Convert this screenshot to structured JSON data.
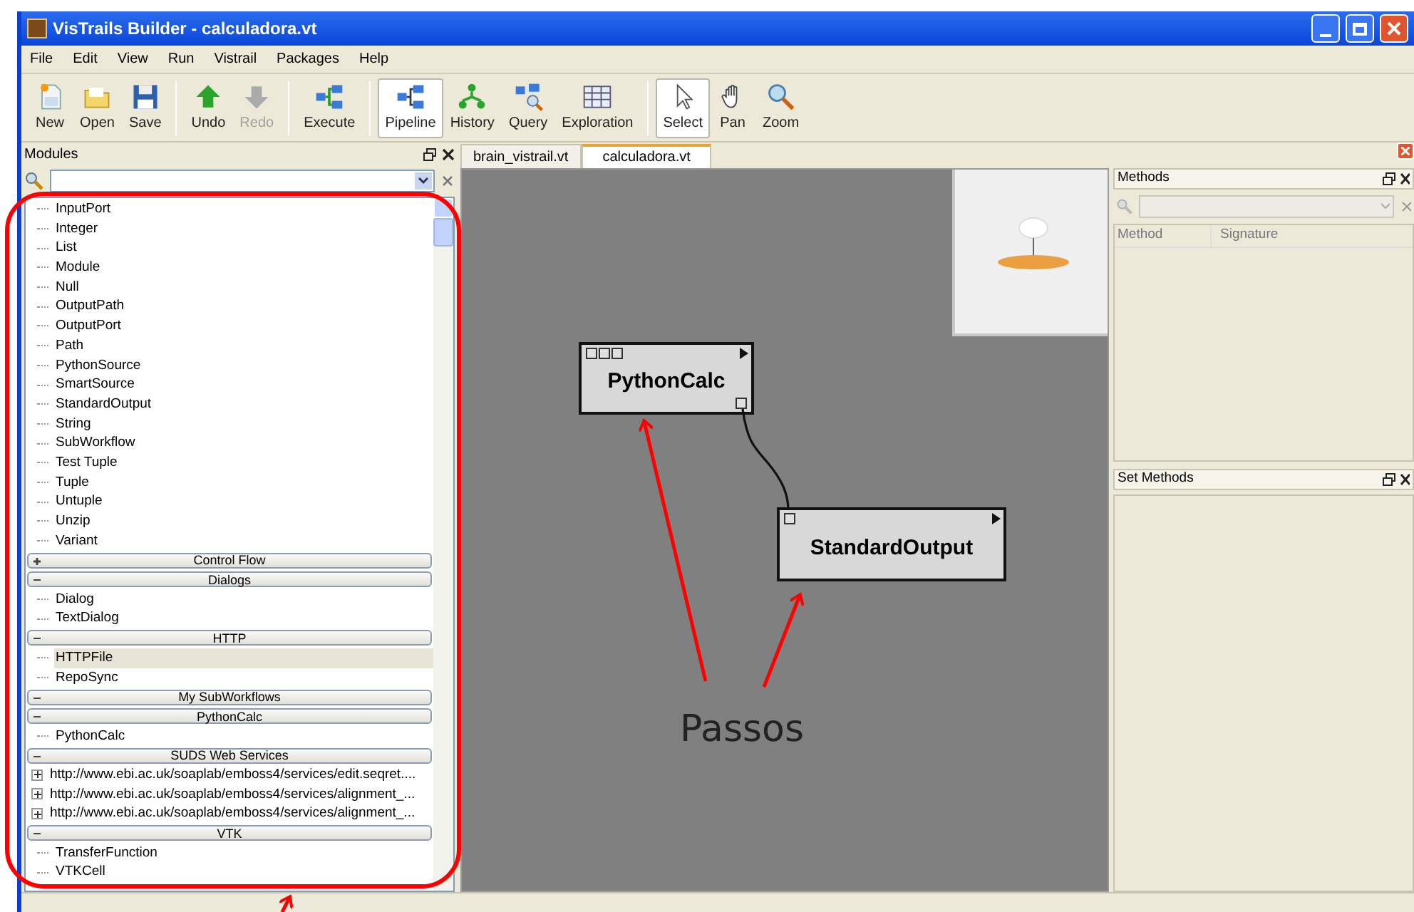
{
  "window": {
    "title": "VisTrails Builder - calculadora.vt"
  },
  "menu": [
    "File",
    "Edit",
    "View",
    "Run",
    "Vistrail",
    "Packages",
    "Help"
  ],
  "toolbar": [
    [
      {
        "label": "New",
        "kind": "new",
        "selected": false,
        "disabled": false
      },
      {
        "label": "Open",
        "kind": "open",
        "selected": false,
        "disabled": false
      },
      {
        "label": "Save",
        "kind": "save",
        "selected": false,
        "disabled": false
      }
    ],
    [
      {
        "label": "Undo",
        "kind": "undo",
        "selected": false,
        "disabled": false
      },
      {
        "label": "Redo",
        "kind": "redo",
        "selected": false,
        "disabled": true
      }
    ],
    [
      {
        "label": "Execute",
        "kind": "execute",
        "selected": false,
        "disabled": false
      }
    ],
    [
      {
        "label": "Pipeline",
        "kind": "pipeline",
        "selected": true,
        "disabled": false
      },
      {
        "label": "History",
        "kind": "history",
        "selected": false,
        "disabled": false
      },
      {
        "label": "Query",
        "kind": "query",
        "selected": false,
        "disabled": false
      },
      {
        "label": "Exploration",
        "kind": "exploration",
        "selected": false,
        "disabled": false
      }
    ],
    [
      {
        "label": "Select",
        "kind": "select",
        "selected": true,
        "disabled": false
      },
      {
        "label": "Pan",
        "kind": "pan",
        "selected": false,
        "disabled": false
      },
      {
        "label": "Zoom",
        "kind": "zoom",
        "selected": false,
        "disabled": false
      }
    ]
  ],
  "modules": {
    "title": "Modules",
    "tree": [
      {
        "kind": "item",
        "label": "InputPort",
        "selected": false
      },
      {
        "kind": "item",
        "label": "Integer",
        "selected": false
      },
      {
        "kind": "item",
        "label": "List",
        "selected": false
      },
      {
        "kind": "item",
        "label": "Module",
        "selected": false
      },
      {
        "kind": "item",
        "label": "Null",
        "selected": false
      },
      {
        "kind": "item",
        "label": "OutputPath",
        "selected": false
      },
      {
        "kind": "item",
        "label": "OutputPort",
        "selected": false
      },
      {
        "kind": "item",
        "label": "Path",
        "selected": false
      },
      {
        "kind": "item",
        "label": "PythonSource",
        "selected": false
      },
      {
        "kind": "item",
        "label": "SmartSource",
        "selected": false
      },
      {
        "kind": "item",
        "label": "StandardOutput",
        "selected": false
      },
      {
        "kind": "item",
        "label": "String",
        "selected": false
      },
      {
        "kind": "item",
        "label": "SubWorkflow",
        "selected": false
      },
      {
        "kind": "item",
        "label": "Test Tuple",
        "selected": false
      },
      {
        "kind": "item",
        "label": "Tuple",
        "selected": false
      },
      {
        "kind": "item",
        "label": "Untuple",
        "selected": false
      },
      {
        "kind": "item",
        "label": "Unzip",
        "selected": false
      },
      {
        "kind": "item",
        "label": "Variant",
        "selected": false
      },
      {
        "kind": "category",
        "label": "Control Flow",
        "expanded": false
      },
      {
        "kind": "category",
        "label": "Dialogs",
        "expanded": true,
        "children": [
          {
            "kind": "item",
            "label": "Dialog",
            "selected": false
          },
          {
            "kind": "item",
            "label": "TextDialog",
            "selected": false
          }
        ]
      },
      {
        "kind": "category",
        "label": "HTTP",
        "expanded": true,
        "children": [
          {
            "kind": "item",
            "label": "HTTPFile",
            "selected": true
          },
          {
            "kind": "item",
            "label": "RepoSync",
            "selected": false
          }
        ]
      },
      {
        "kind": "category",
        "label": "My SubWorkflows",
        "expanded": true
      },
      {
        "kind": "category",
        "label": "PythonCalc",
        "expanded": true,
        "children": [
          {
            "kind": "item",
            "label": "PythonCalc",
            "selected": false
          }
        ]
      },
      {
        "kind": "category",
        "label": "SUDS Web Services",
        "expanded": true,
        "children": [
          {
            "kind": "group",
            "label": "http://www.ebi.ac.uk/soaplab/emboss4/services/edit.seqret....",
            "expanded": false,
            "selected": false
          },
          {
            "kind": "group",
            "label": "http://www.ebi.ac.uk/soaplab/emboss4/services/alignment_...",
            "expanded": false,
            "selected": false
          },
          {
            "kind": "group",
            "label": "http://www.ebi.ac.uk/soaplab/emboss4/services/alignment_...",
            "expanded": false,
            "selected": false
          }
        ]
      },
      {
        "kind": "category",
        "label": "VTK",
        "expanded": true,
        "children": [
          {
            "kind": "item",
            "label": "TransferFunction",
            "selected": false
          },
          {
            "kind": "item",
            "label": "VTKCell",
            "selected": false
          }
        ]
      }
    ]
  },
  "tabs": [
    {
      "label": "brain_vistrail.vt",
      "selected": false
    },
    {
      "label": "calculadora.vt",
      "selected": true
    }
  ],
  "pipeline": {
    "modules": [
      {
        "label": "PythonCalc"
      },
      {
        "label": "StandardOutput"
      }
    ]
  },
  "methods": {
    "title": "Methods",
    "columns": [
      "Method",
      "Signature"
    ]
  },
  "set_methods": {
    "title": "Set Methods"
  },
  "annotation": {
    "label": "Passos"
  }
}
